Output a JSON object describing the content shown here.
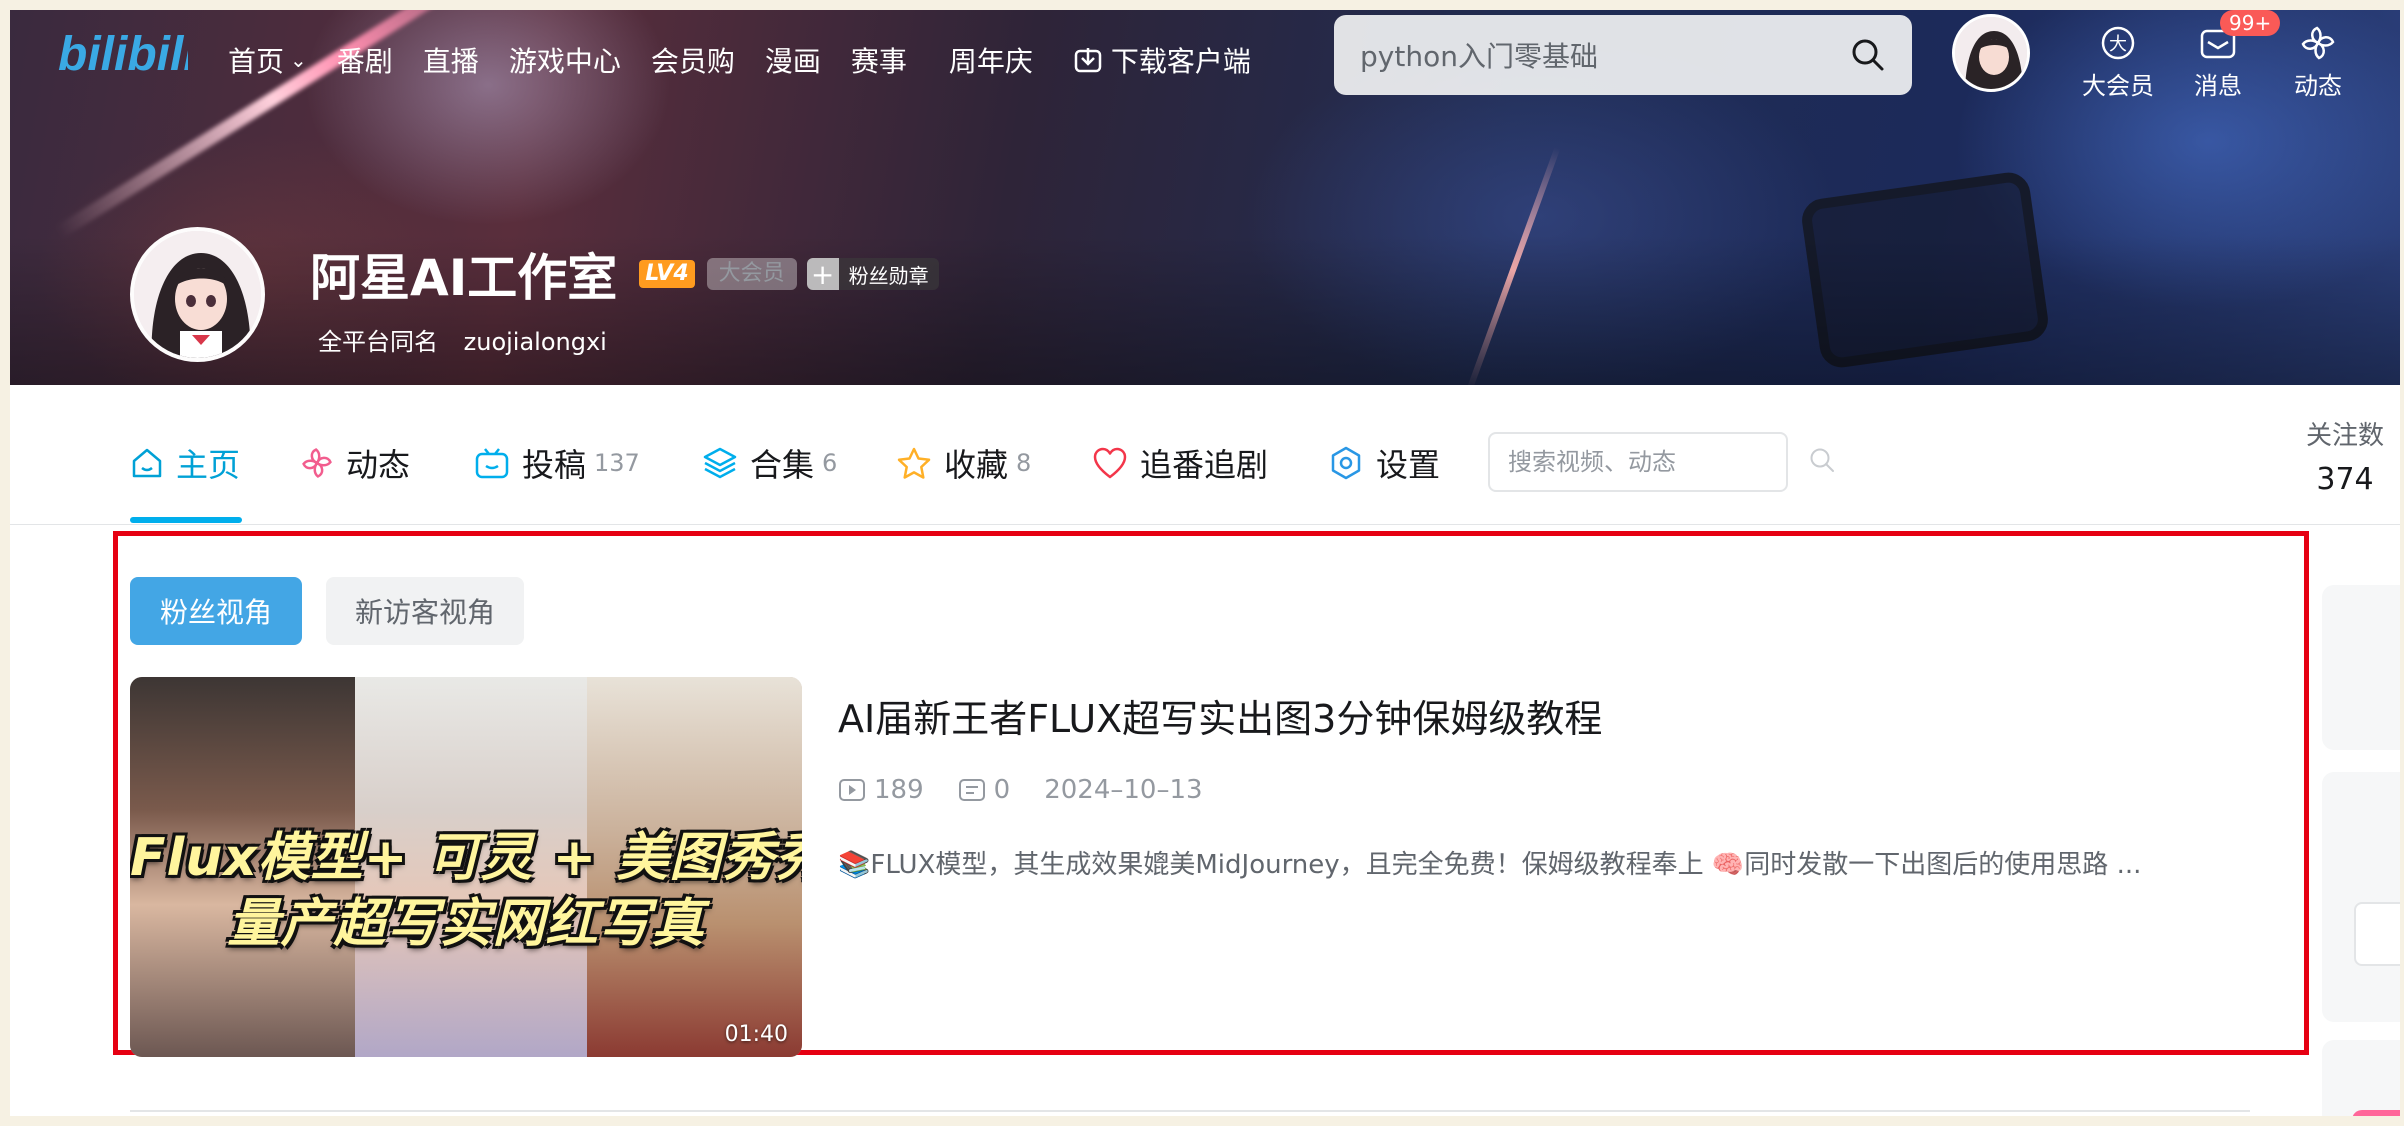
{
  "nav": {
    "items": [
      {
        "label": "首页",
        "dropdown": true
      },
      {
        "label": "番剧"
      },
      {
        "label": "直播"
      },
      {
        "label": "游戏中心"
      },
      {
        "label": "会员购"
      },
      {
        "label": "漫画"
      },
      {
        "label": "赛事"
      },
      {
        "label": "周年庆"
      },
      {
        "label": "下载客户端",
        "icon": "download-icon"
      }
    ],
    "search_value": "python入门零基础",
    "right": {
      "vip": "大会员",
      "messages": "消息",
      "messages_badge": "99+",
      "dynamic": "动态"
    }
  },
  "profile": {
    "name": "阿星AI工作室",
    "level": "LV4",
    "vip_tag": "大会员",
    "medal_label": "粉丝勋章",
    "alias_label": "全平台同名",
    "alias_value": "zuojialongxi"
  },
  "tabs": [
    {
      "label": "主页",
      "count": "",
      "icon": "home-icon",
      "active": true
    },
    {
      "label": "动态",
      "count": "",
      "icon": "pinwheel-icon"
    },
    {
      "label": "投稿",
      "count": "137",
      "icon": "tv-icon"
    },
    {
      "label": "合集",
      "count": "6",
      "icon": "layers-icon"
    },
    {
      "label": "收藏",
      "count": "8",
      "icon": "star-icon"
    },
    {
      "label": "追番追剧",
      "count": "",
      "icon": "heart-icon"
    },
    {
      "label": "设置",
      "count": "",
      "icon": "hexagon-gear-icon"
    }
  ],
  "space_search_placeholder": "搜索视频、动态",
  "follow": {
    "label": "关注数",
    "value": "374"
  },
  "view_toggle": {
    "fan": "粉丝视角",
    "new_visitor": "新访客视角"
  },
  "video": {
    "thumb_caption_1": "Flux模型+ 可灵 + 美图秀秀",
    "thumb_caption_2": "量产超写实网红写真",
    "duration": "01:40",
    "title": "AI届新王者FLUX超写实出图3分钟保姆级教程",
    "plays": "189",
    "comments": "0",
    "date": "2024–10–13",
    "desc": "📚FLUX模型，其生成效果媲美MidJourney，且完全免费！保姆级教程奉上 🧠同时发散一下出图后的使用思路 ..."
  },
  "colors": {
    "accent": "#00aeec",
    "fan_button": "#43a6e5",
    "highlight_border": "#e60012",
    "badge": "#fa5a57",
    "level": "#ff9b1f"
  }
}
